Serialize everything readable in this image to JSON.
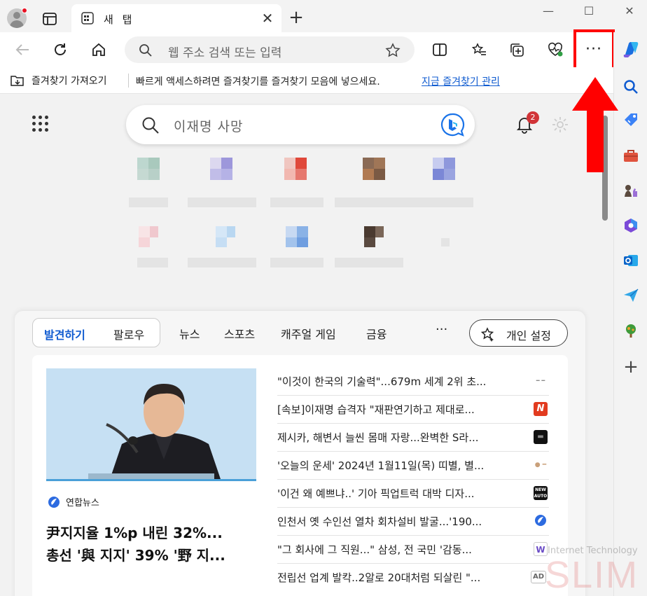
{
  "tab": {
    "title": "새 탭"
  },
  "address_bar": {
    "placeholder": "웹 주소 검색 또는 입력"
  },
  "favorites_bar": {
    "import_label": "즐겨찾기 가져오기",
    "message": "빠르게 액세스하려면 즐겨찾기를 즐겨찾기 모음에 넣으세요.",
    "manage_link": "지금 즐겨찾기 관리"
  },
  "ntp": {
    "search_text": "이재명 사망",
    "notification_count": "2"
  },
  "feed": {
    "tabs": [
      "발견하기",
      "팔로우"
    ],
    "categories": [
      "뉴스",
      "스포츠",
      "캐주얼 게임",
      "금융"
    ],
    "more_label": "···",
    "personal_settings": "개인 설정",
    "main_story": {
      "source": "연합뉴스",
      "headline_line1": "尹지지율 1%p 내린 32%...",
      "headline_line2": "총선 '與 지지' 39% '野 지..."
    },
    "news": [
      {
        "title": "\"이것이 한국의 기술력\"...679m 세계 2위 초...",
        "logo": ""
      },
      {
        "title": "[속보]이재명 습격자 \"재판연기하고 제대로...",
        "logo": "N"
      },
      {
        "title": "제시카, 해변서 늘씬 몸매 자랑...완벽한 S라...",
        "logo": ""
      },
      {
        "title": "'오늘의 운세' 2024년 1월11일(목) 띠별, 별...",
        "logo": ""
      },
      {
        "title": "'이건 왜 예쁘냐..' 기아 픽업트럭 대박 디자...",
        "logo": "NEW AUTO"
      },
      {
        "title": "인천서 옛 수인선 열차 회차설비 발굴...'190...",
        "logo": ""
      },
      {
        "title": "\"그 회사에 그 직원...\" 삼성, 전 국민 '감동...",
        "logo": "W"
      },
      {
        "title": "전립선 업계 발칵..2알로 20대처럼 되살린 \"...",
        "logo": "AD"
      }
    ]
  },
  "watermark": {
    "top": "Internet Technology",
    "main": "SLIM"
  },
  "colors": {
    "accent": "#0f5bd0",
    "highlight": "#ff0000",
    "badge": "#d13438"
  }
}
